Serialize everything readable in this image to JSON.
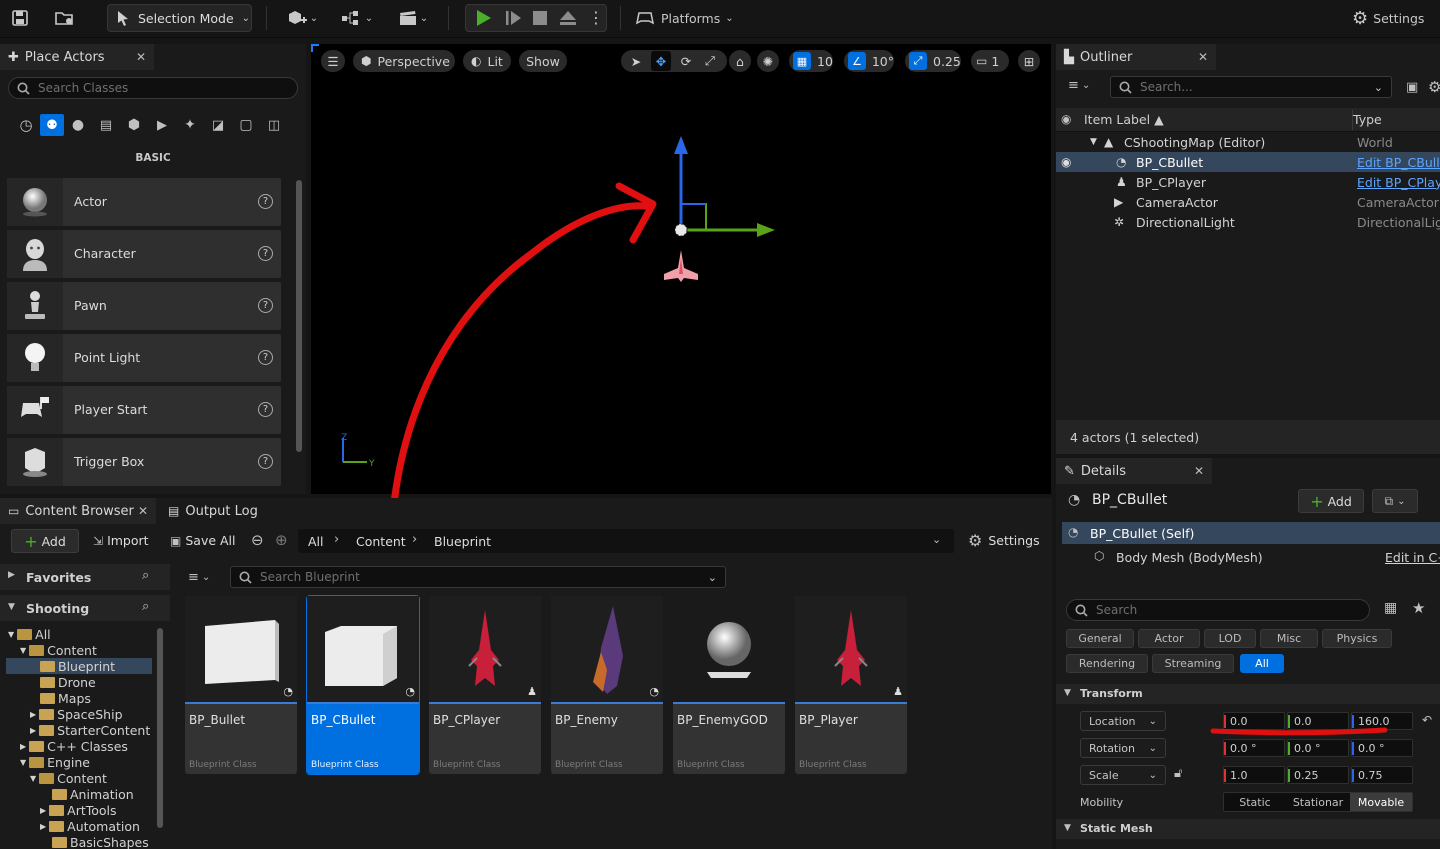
{
  "toolbar": {
    "mode_label": "Selection Mode",
    "platforms_label": "Platforms",
    "settings_label": "Settings"
  },
  "place_actors": {
    "tab_title": "Place Actors",
    "search_placeholder": "Search Classes",
    "section_label": "BASIC",
    "items": [
      {
        "label": "Actor",
        "icon": "sphere-icon"
      },
      {
        "label": "Character",
        "icon": "character-icon"
      },
      {
        "label": "Pawn",
        "icon": "pawn-icon"
      },
      {
        "label": "Point Light",
        "icon": "bulb-icon"
      },
      {
        "label": "Player Start",
        "icon": "player-start-icon"
      },
      {
        "label": "Trigger Box",
        "icon": "trigger-box-icon"
      }
    ]
  },
  "viewport": {
    "perspective_label": "Perspective",
    "lit_label": "Lit",
    "show_label": "Show",
    "grid_snap": "10",
    "rotation_snap": "10°",
    "scale_snap": "0.25",
    "camera_speed": "1",
    "axis_z": "Z",
    "axis_y": "Y"
  },
  "outliner": {
    "tab_title": "Outliner",
    "search_placeholder": "Search...",
    "col_label": "Item Label ▲",
    "col_type": "Type",
    "rows": [
      {
        "label": "CShootingMap (Editor)",
        "type": "World",
        "link": false
      },
      {
        "label": "BP_CBullet",
        "type": "Edit BP_CBulle",
        "link": true
      },
      {
        "label": "BP_CPlayer",
        "type": "Edit BP_CPlaye",
        "link": true
      },
      {
        "label": "CameraActor",
        "type": "CameraActor",
        "link": false
      },
      {
        "label": "DirectionalLight",
        "type": "DirectionalLigh",
        "link": false
      }
    ],
    "footer": "4 actors (1 selected)"
  },
  "details": {
    "tab_title": "Details",
    "object_name": "BP_CBullet",
    "add_label": "Add",
    "self_label": "BP_CBullet (Self)",
    "component_label": "Body Mesh (BodyMesh)",
    "component_link": "Edit in C++",
    "search_placeholder": "Search",
    "categories": [
      "General",
      "Actor",
      "LOD",
      "Misc",
      "Physics",
      "Rendering",
      "Streaming",
      "All"
    ],
    "transform_header": "Transform",
    "location_label": "Location",
    "location": [
      "0.0",
      "0.0",
      "160.0"
    ],
    "rotation_label": "Rotation",
    "rotation": [
      "0.0 °",
      "0.0 °",
      "0.0 °"
    ],
    "scale_label": "Scale",
    "scale": [
      "1.0",
      "0.25",
      "0.75"
    ],
    "mobility_label": "Mobility",
    "mobility_options": [
      "Static",
      "Stationar",
      "Movable"
    ],
    "static_mesh_header": "Static Mesh"
  },
  "content_browser": {
    "tab_title": "Content Browser",
    "output_log_title": "Output Log",
    "add_label": "Add",
    "import_label": "Import",
    "save_all_label": "Save All",
    "breadcrumb": [
      "All",
      "Content",
      "Blueprint"
    ],
    "settings_label": "Settings",
    "favorites_label": "Favorites",
    "shooting_label": "Shooting",
    "search_placeholder": "Search Blueprint",
    "tree": [
      {
        "label": "All",
        "depth": 0
      },
      {
        "label": "Content",
        "depth": 1
      },
      {
        "label": "Blueprint",
        "depth": 2
      },
      {
        "label": "Drone",
        "depth": 2
      },
      {
        "label": "Maps",
        "depth": 2
      },
      {
        "label": "SpaceShip",
        "depth": 2
      },
      {
        "label": "StarterContent",
        "depth": 2
      },
      {
        "label": "C++ Classes",
        "depth": 1
      },
      {
        "label": "Engine",
        "depth": 1
      },
      {
        "label": "Content",
        "depth": 2
      },
      {
        "label": "Animation",
        "depth": 3
      },
      {
        "label": "ArtTools",
        "depth": 3
      },
      {
        "label": "Automation",
        "depth": 3
      },
      {
        "label": "BasicShapes",
        "depth": 3
      }
    ],
    "assets": [
      {
        "name": "BP_Bullet",
        "kind": "Blueprint Class"
      },
      {
        "name": "BP_CBullet",
        "kind": "Blueprint Class"
      },
      {
        "name": "BP_CPlayer",
        "kind": "Blueprint Class"
      },
      {
        "name": "BP_Enemy",
        "kind": "Blueprint Class"
      },
      {
        "name": "BP_EnemyGOD",
        "kind": "Blueprint Class"
      },
      {
        "name": "BP_Player",
        "kind": "Blueprint Class"
      }
    ]
  },
  "colors": {
    "accent": "#0070e0",
    "annotation": "#e01010",
    "play": "#4caf2a"
  }
}
